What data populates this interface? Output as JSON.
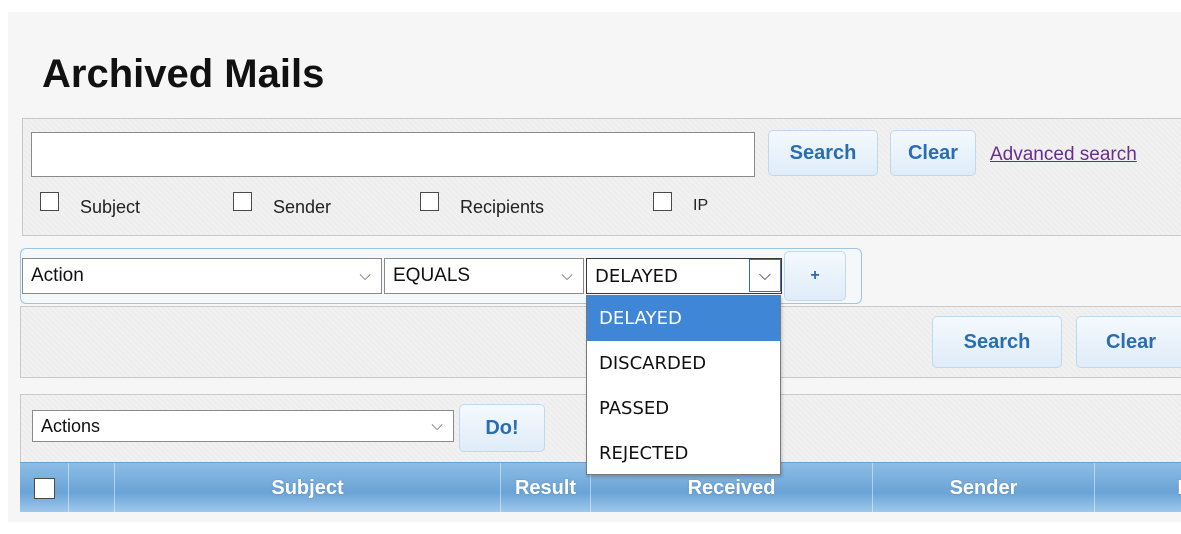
{
  "page": {
    "title": "Archived Mails"
  },
  "quick_search": {
    "query_value": "",
    "search_label": "Search",
    "clear_label": "Clear",
    "advanced_link": "Advanced search",
    "fields": [
      {
        "label": "Subject",
        "checked": false
      },
      {
        "label": "Sender",
        "checked": false
      },
      {
        "label": "Recipients",
        "checked": false
      },
      {
        "label": "IP",
        "checked": false
      }
    ]
  },
  "filter": {
    "field_value": "Action",
    "operator_value": "EQUALS",
    "value_value": "DELAYED",
    "add_label": "+",
    "search_label": "Search",
    "clear_label": "Clear",
    "value_options": [
      "DELAYED",
      "DISCARDED",
      "PASSED",
      "REJECTED"
    ],
    "highlighted_option": "DELAYED"
  },
  "bulk": {
    "actions_value": "Actions",
    "do_label": "Do!"
  },
  "table": {
    "columns": [
      "Subject",
      "Result",
      "Received",
      "Sender",
      "I"
    ]
  },
  "colors": {
    "accent": "#3f86d6",
    "header_blue": "#7ab0dd",
    "link": "#6b2c91",
    "button_text": "#2a6db0"
  }
}
